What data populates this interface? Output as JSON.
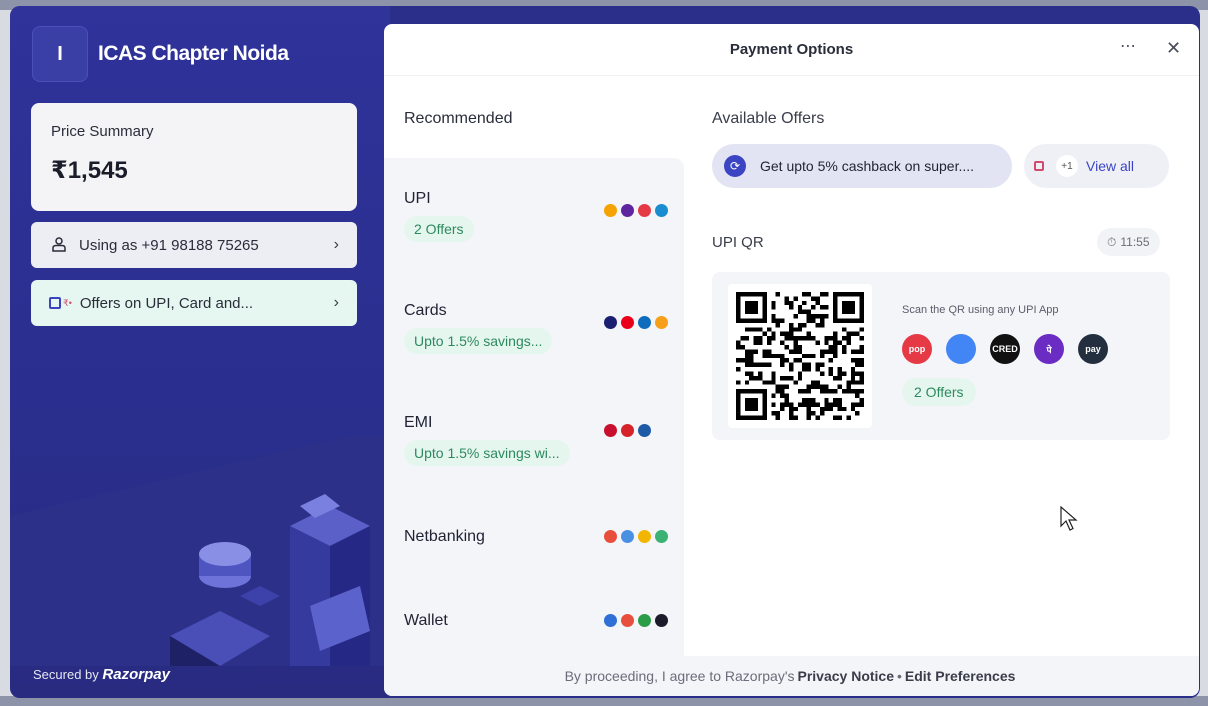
{
  "merchant": {
    "initial": "I",
    "name": "ICAS Chapter Noida"
  },
  "price_summary": {
    "label": "Price Summary",
    "value": "₹1,545"
  },
  "user": {
    "label": "Using as +91 98188 75265"
  },
  "offers_row": {
    "label": "Offers on UPI, Card and..."
  },
  "secured": {
    "prefix": "Secured by",
    "brand": "Razorpay"
  },
  "header": {
    "title": "Payment Options",
    "more_icon": "⋯",
    "close_icon": "✕"
  },
  "recommended_title": "Recommended",
  "methods": [
    {
      "name": "UPI",
      "badge": "2 Offers"
    },
    {
      "name": "Cards",
      "badge": "Upto 1.5% savings..."
    },
    {
      "name": "EMI",
      "badge": "Upto 1.5% savings wi..."
    },
    {
      "name": "Netbanking",
      "badge": ""
    },
    {
      "name": "Wallet",
      "badge": ""
    }
  ],
  "available_offers": {
    "title": "Available Offers",
    "offer_text": "Get upto 5% cashback on super....",
    "more_count": "+1",
    "view_all": "View all"
  },
  "upi_qr": {
    "title": "UPI QR",
    "timer": "11:55",
    "scan_text": "Scan the QR using any UPI App",
    "offers_badge": "2 Offers",
    "apps": [
      {
        "name": "bhim-icon",
        "label": "pop",
        "color": "#e63946"
      },
      {
        "name": "google-pay-icon",
        "label": "",
        "color": "#4285f4"
      },
      {
        "name": "cred-icon",
        "label": "CRED",
        "color": "#111111"
      },
      {
        "name": "phonepe-icon",
        "label": "पे",
        "color": "#6a2cc2"
      },
      {
        "name": "amazon-pay-icon",
        "label": "pay",
        "color": "#232f3e"
      }
    ]
  },
  "footer": {
    "prefix": "By proceeding, I agree to Razorpay's",
    "privacy": "Privacy Notice",
    "sep": "•",
    "edit": "Edit Preferences"
  },
  "colors": {
    "brand": "#2b2f8a",
    "accent": "#3b45c4",
    "offer_green": "#2d8a5f"
  }
}
